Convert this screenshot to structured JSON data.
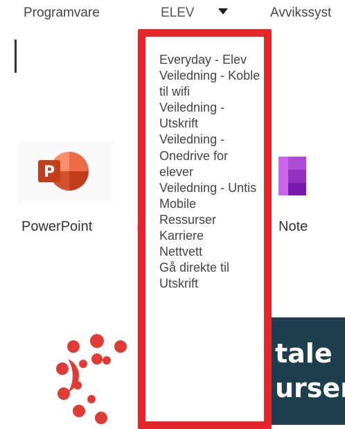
{
  "nav": {
    "programvare": "Programvare",
    "elev": "ELEV",
    "avvik": "Avvikssyst"
  },
  "apps": {
    "powerpoint": "PowerPoint",
    "onenote_partial": "Note",
    "hidden_stub": "("
  },
  "dropdown": {
    "items": [
      "Everyday - Elev",
      "Veiledning - Koble til wifi",
      "Veiledning - Utskrift",
      "Veiledning - Onedrive for elever",
      "Veiledning - Untis Mobile",
      "Ressurser",
      "Karriere",
      "Nettvett",
      "Gå direkte til Utskrift"
    ]
  },
  "banner": {
    "line1": "tale",
    "line2": "urser"
  },
  "colors": {
    "highlight": "#e5262b",
    "banner": "#1e3f4d",
    "powerpoint": "#c43e1c",
    "onenote": "#7719aa",
    "canvas": "#e13b36"
  }
}
